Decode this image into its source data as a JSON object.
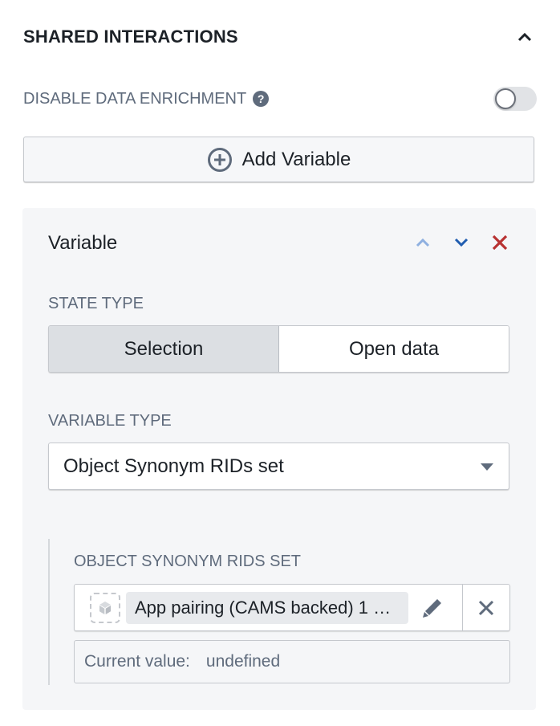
{
  "section": {
    "title": "SHARED INTERACTIONS",
    "collapse_icon": "chevron-up-icon"
  },
  "enrichment": {
    "label": "DISABLE DATA ENRICHMENT",
    "help_icon": "?",
    "toggle_on": false
  },
  "add_variable": {
    "label": "Add Variable",
    "icon": "plus-circle-icon"
  },
  "variable": {
    "title": "Variable",
    "actions": [
      "move-up",
      "move-down",
      "delete"
    ],
    "colors": {
      "up": "#8fb0e0",
      "down": "#215db0",
      "delete": "#b83232"
    },
    "state_type": {
      "label": "STATE TYPE",
      "options": [
        "Selection",
        "Open data"
      ],
      "selected": "Selection"
    },
    "variable_type": {
      "label": "VARIABLE TYPE",
      "value": "Object Synonym RIDs set"
    },
    "object_set": {
      "label": "OBJECT SYNONYM RIDS SET",
      "chip_text": "App pairing (CAMS backed) 1 …",
      "current_value_label": "Current value:",
      "current_value": "undefined"
    }
  }
}
